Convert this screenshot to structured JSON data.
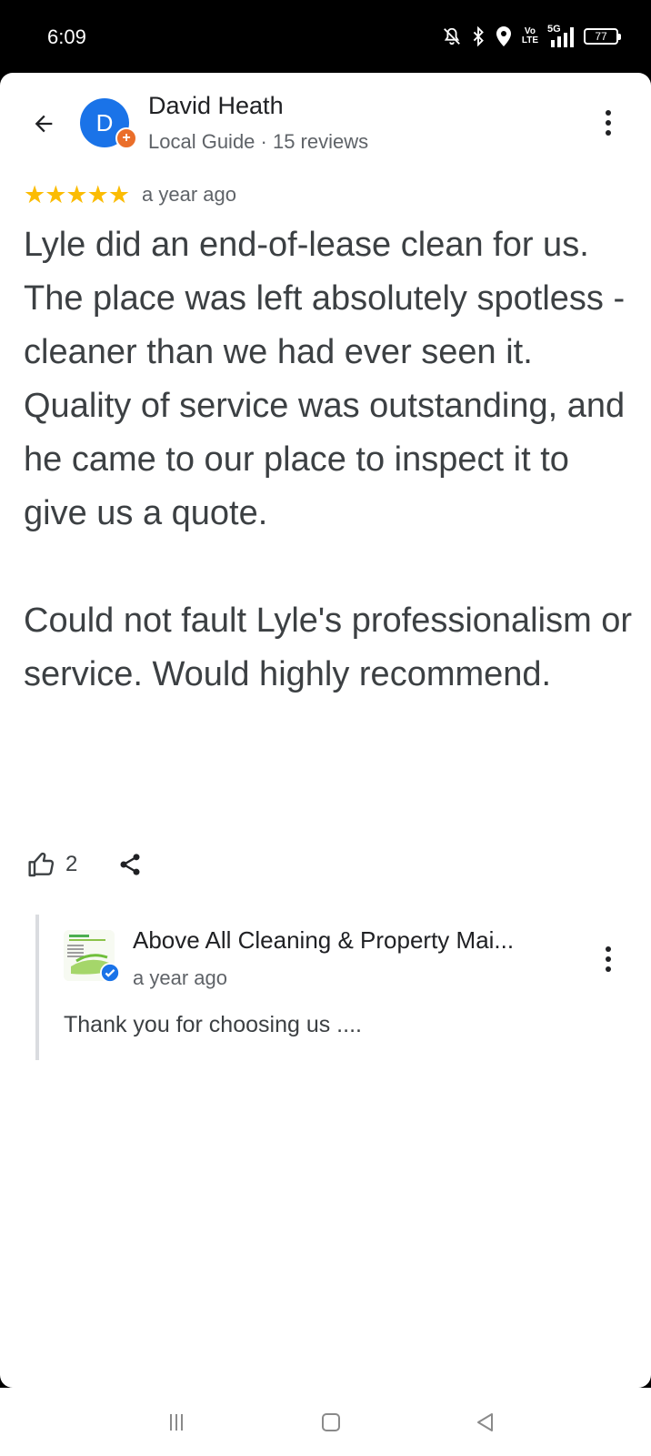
{
  "status_bar": {
    "time": "6:09",
    "network_type": "5G",
    "volte_top": "Vo",
    "volte_bottom": "LTE",
    "battery_level": "77",
    "icons": [
      "mute-icon",
      "bluetooth-icon",
      "location-icon",
      "volte-icon",
      "signal-icon",
      "battery-icon"
    ]
  },
  "header": {
    "back_icon": "arrow-back-icon",
    "avatar_letter": "D",
    "avatar_color": "#1a73e8",
    "badge_color": "#ea6e2a",
    "reviewer_name": "David Heath",
    "reviewer_meta": "Local Guide · 15 reviews",
    "menu_icon": "more-vert-icon"
  },
  "review": {
    "stars": "★★★★★",
    "rating": 5,
    "star_color": "#fbbc04",
    "time": "a year ago",
    "text": "Lyle did an end-of-lease clean for us. The place was left absolutely spotless - cleaner than we had ever seen it. Quality of service was outstanding, and he came to our place to inspect it to give us a quote.\n\nCould not fault Lyle's professionalism or service. Would highly recommend.",
    "like_count": "2",
    "like_icon": "thumb-up-icon",
    "share_icon": "share-icon"
  },
  "owner_reply": {
    "name": "Above All Cleaning & Property Mai...",
    "time": "a year ago",
    "text": "Thank you for choosing us ....",
    "verified_icon": "verified-icon",
    "menu_icon": "more-vert-icon"
  },
  "nav_bar": {
    "icons": [
      "menu-lines-icon",
      "home-square-icon",
      "back-triangle-icon"
    ]
  }
}
